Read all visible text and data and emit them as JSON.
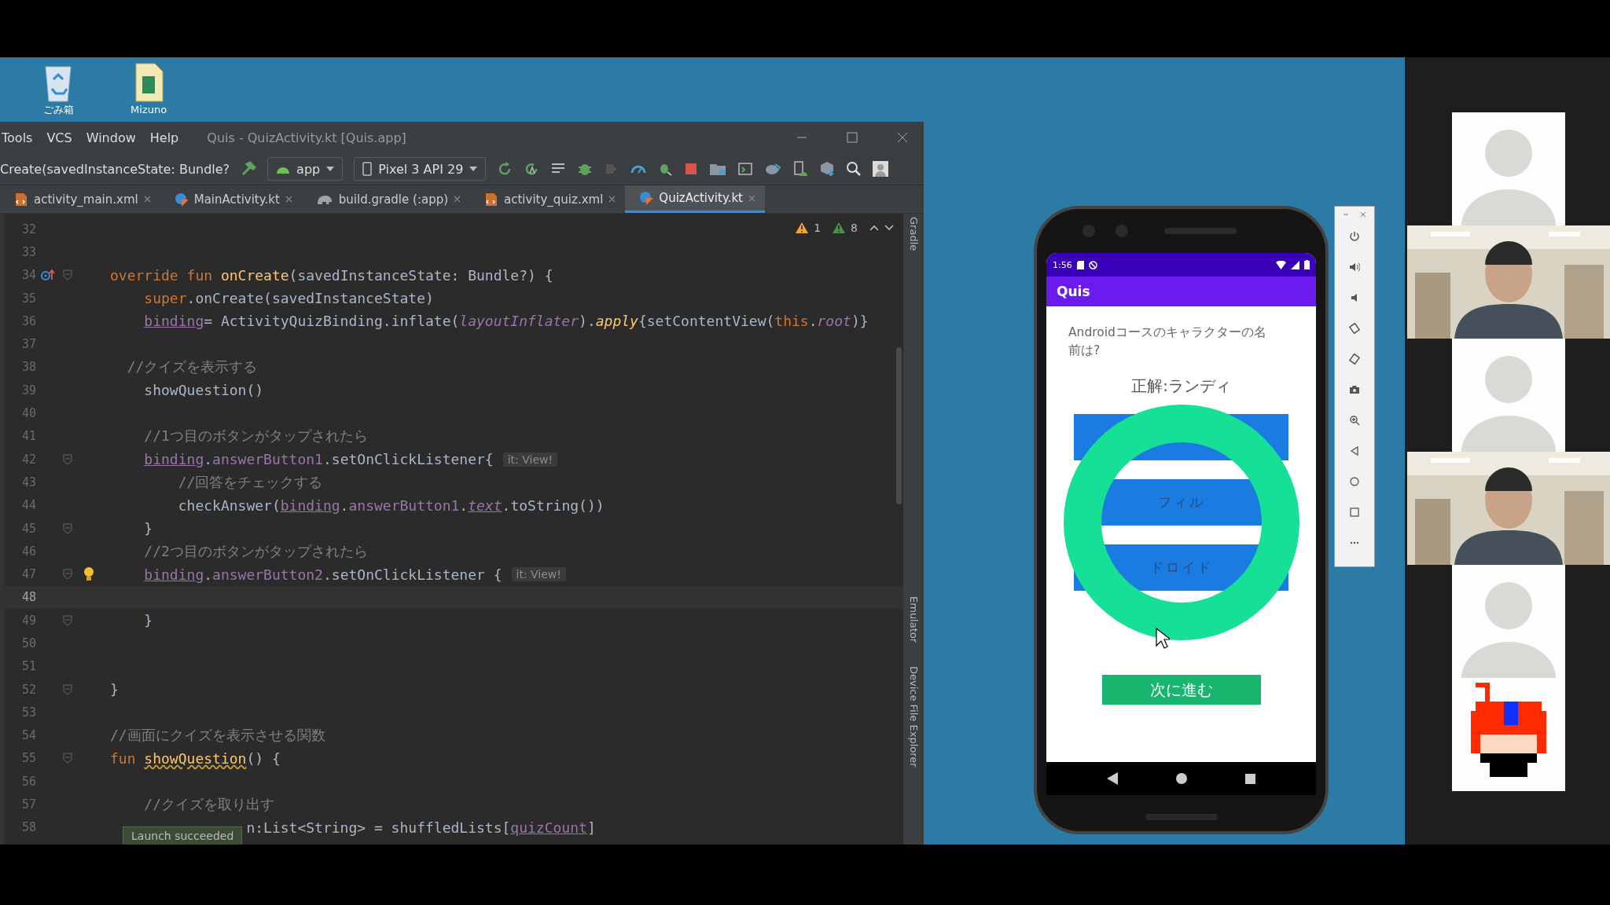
{
  "desktop": {
    "icons": [
      {
        "label": "ごみ箱",
        "kind": "recycle-bin"
      },
      {
        "label": "Mizuno",
        "kind": "document"
      }
    ]
  },
  "ide": {
    "menu": [
      "Tools",
      "VCS",
      "Window",
      "Help"
    ],
    "title": "Quis - QuizActivity.kt [Quis.app]",
    "breadcrumb": "Create(savedInstanceState: Bundle?",
    "run_config": "app",
    "device": "Pixel 3 API 29",
    "tabs": [
      {
        "label": "activity_main.xml",
        "kind": "xml",
        "selected": false
      },
      {
        "label": "MainActivity.kt",
        "kind": "kotlin",
        "selected": false
      },
      {
        "label": "build.gradle (:app)",
        "kind": "gradle",
        "selected": false
      },
      {
        "label": "activity_quiz.xml",
        "kind": "xml",
        "selected": false
      },
      {
        "label": "QuizActivity.kt",
        "kind": "kotlin",
        "selected": true
      }
    ],
    "inspections": {
      "warnings": "1",
      "weak_warnings": "8"
    },
    "lines": [
      {
        "number": "32",
        "fold": false,
        "current": false
      },
      {
        "number": "33",
        "fold": false,
        "current": false
      },
      {
        "number": "34",
        "fold": true,
        "current": false,
        "kind": "override",
        "tokens": [
          {
            "text": "override ",
            "kind": "kw"
          },
          {
            "text": "fun ",
            "kind": "kw"
          },
          {
            "text": "onCreate",
            "kind": "fn"
          },
          {
            "text": "(savedInstanceState: Bundle?) {",
            "kind": "p"
          }
        ]
      },
      {
        "number": "35",
        "fold": false,
        "current": false,
        "tokens": [
          {
            "text": "    super",
            "kind": "kw"
          },
          {
            "text": ".onCreate(savedInstanceState)",
            "kind": "p"
          }
        ]
      },
      {
        "number": "36",
        "fold": false,
        "current": false,
        "tokens": [
          {
            "text": "    binding",
            "kind": "prop"
          },
          {
            "text": "= ActivityQuizBinding.inflate(",
            "kind": "p"
          },
          {
            "text": "layoutInflater",
            "kind": "ital"
          },
          {
            "text": ").",
            "kind": "p"
          },
          {
            "text": "apply",
            "kind": "ext"
          },
          {
            "text": "{setContentView(",
            "kind": "p"
          },
          {
            "text": "this",
            "kind": "kw"
          },
          {
            "text": ".",
            "kind": "p"
          },
          {
            "text": "root",
            "kind": "ital"
          },
          {
            "text": ")}",
            "kind": "p"
          }
        ]
      },
      {
        "number": "37",
        "fold": false,
        "current": false
      },
      {
        "number": "38",
        "fold": false,
        "current": false,
        "tokens": [
          {
            "text": "  //クイズを表示する",
            "kind": "comment"
          }
        ]
      },
      {
        "number": "39",
        "fold": false,
        "current": false,
        "tokens": [
          {
            "text": "    showQuestion()",
            "kind": "p"
          }
        ]
      },
      {
        "number": "40",
        "fold": false,
        "current": false
      },
      {
        "number": "41",
        "fold": false,
        "current": false,
        "tokens": [
          {
            "text": "    //1つ目のボタンがタップされたら",
            "kind": "comment"
          }
        ]
      },
      {
        "number": "42",
        "fold": true,
        "current": false,
        "hint": "it: View!",
        "tokens": [
          {
            "text": "    binding",
            "kind": "prop"
          },
          {
            "text": ".",
            "kind": "p"
          },
          {
            "text": "answerButton1",
            "kind": "member"
          },
          {
            "text": ".setOnClickListener{",
            "kind": "p"
          }
        ]
      },
      {
        "number": "43",
        "fold": false,
        "current": false,
        "tokens": [
          {
            "text": "        //回答をチェックする",
            "kind": "comment"
          }
        ]
      },
      {
        "number": "44",
        "fold": false,
        "current": false,
        "tokens": [
          {
            "text": "        checkAnswer(",
            "kind": "p"
          },
          {
            "text": "binding",
            "kind": "prop"
          },
          {
            "text": ".",
            "kind": "p"
          },
          {
            "text": "answerButton1",
            "kind": "member"
          },
          {
            "text": ".",
            "kind": "p"
          },
          {
            "text": "text",
            "kind": "ital-prop"
          },
          {
            "text": ".toString())",
            "kind": "p"
          }
        ]
      },
      {
        "number": "45",
        "fold": true,
        "current": false,
        "tokens": [
          {
            "text": "    }",
            "kind": "p"
          }
        ]
      },
      {
        "number": "46",
        "fold": false,
        "current": false,
        "tokens": [
          {
            "text": "    //2つ目のボタンがタップされたら",
            "kind": "comment"
          }
        ]
      },
      {
        "number": "47",
        "fold": true,
        "current": false,
        "kind": "bulb",
        "hint": "it: View!",
        "tokens": [
          {
            "text": "    binding",
            "kind": "prop"
          },
          {
            "text": ".",
            "kind": "p"
          },
          {
            "text": "answerButton2",
            "kind": "member"
          },
          {
            "text": ".setOnClickListener {",
            "kind": "p"
          }
        ]
      },
      {
        "number": "48",
        "fold": false,
        "current": true
      },
      {
        "number": "49",
        "fold": true,
        "current": false,
        "tokens": [
          {
            "text": "    }",
            "kind": "p"
          }
        ]
      },
      {
        "number": "50",
        "fold": false,
        "current": false
      },
      {
        "number": "51",
        "fold": false,
        "current": false
      },
      {
        "number": "52",
        "fold": true,
        "current": false,
        "tokens": [
          {
            "text": "}",
            "kind": "p"
          }
        ]
      },
      {
        "number": "53",
        "fold": false,
        "current": false
      },
      {
        "number": "54",
        "fold": false,
        "current": false,
        "tokens": [
          {
            "text": "//画面にクイズを表示させる関数",
            "kind": "comment"
          }
        ]
      },
      {
        "number": "55",
        "fold": true,
        "current": false,
        "tokens": [
          {
            "text": "fun ",
            "kind": "kw"
          },
          {
            "text": "showQuestion",
            "kind": "fn-warn"
          },
          {
            "text": "() {",
            "kind": "p"
          }
        ]
      },
      {
        "number": "56",
        "fold": false,
        "current": false
      },
      {
        "number": "57",
        "fold": false,
        "current": false,
        "tokens": [
          {
            "text": "    //クイズを取り出す",
            "kind": "comment"
          }
        ]
      },
      {
        "number": "58",
        "fold": false,
        "current": false,
        "tokens": [
          {
            "text": "                n:List<String> = shuffledLists[",
            "kind": "p"
          },
          {
            "text": "quizCount",
            "kind": "prop"
          },
          {
            "text": "]",
            "kind": "p"
          }
        ]
      }
    ],
    "toast": "Launch succeeded",
    "side_tools": [
      "Gradle",
      "Emulator",
      "Device File Explorer"
    ]
  },
  "phone": {
    "time": "1:56",
    "app_title": "Quis",
    "question": "Androidコースのキャラクターの名前は?",
    "answer": "正解:ランディ",
    "answer_buttons": [
      {
        "kind": "blank"
      },
      {
        "kind": "labeled",
        "label": "フィル"
      },
      {
        "kind": "labeled",
        "label": "ドロイド"
      }
    ],
    "correct": true,
    "next_button": "次に進む"
  },
  "participants": [
    {
      "kind": "placeholder"
    },
    {
      "kind": "video"
    },
    {
      "kind": "placeholder"
    },
    {
      "kind": "video"
    },
    {
      "kind": "placeholder"
    },
    {
      "kind": "pixel-avatar"
    }
  ]
}
